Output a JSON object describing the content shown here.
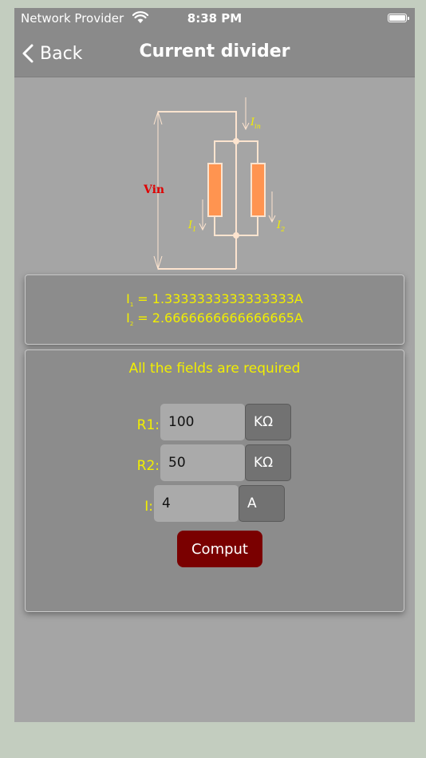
{
  "status_bar": {
    "carrier": "Network Provider",
    "time": "8:38 PM"
  },
  "nav": {
    "back_label": "Back",
    "title": "Current divider"
  },
  "diagram": {
    "vin_label": "Vin",
    "iin_label": "I",
    "iin_sub": "in",
    "i1_label": "I",
    "i1_sub": "1",
    "i2_label": "I",
    "i2_sub": "2"
  },
  "result": {
    "line1_symbol": "I",
    "line1_sub": "1",
    "line1_value": "= 1.3333333333333333A",
    "line2_symbol": "I",
    "line2_sub": "2",
    "line2_value": "= 2.6666666666666665A"
  },
  "form": {
    "required_note": "All the fields are required",
    "r1_label": "R1:",
    "r1_value": "100",
    "r1_unit": "KΩ",
    "r2_label": "R2:",
    "r2_value": "50",
    "r2_unit": "KΩ",
    "i_label": "I:",
    "i_value": "4",
    "i_unit": "A",
    "comput_label": "Comput"
  },
  "colors": {
    "accent_yellow": "#f2ef00",
    "button_red": "#7a0000",
    "resistor_orange": "#ff9450",
    "vin_red": "#e00000"
  }
}
